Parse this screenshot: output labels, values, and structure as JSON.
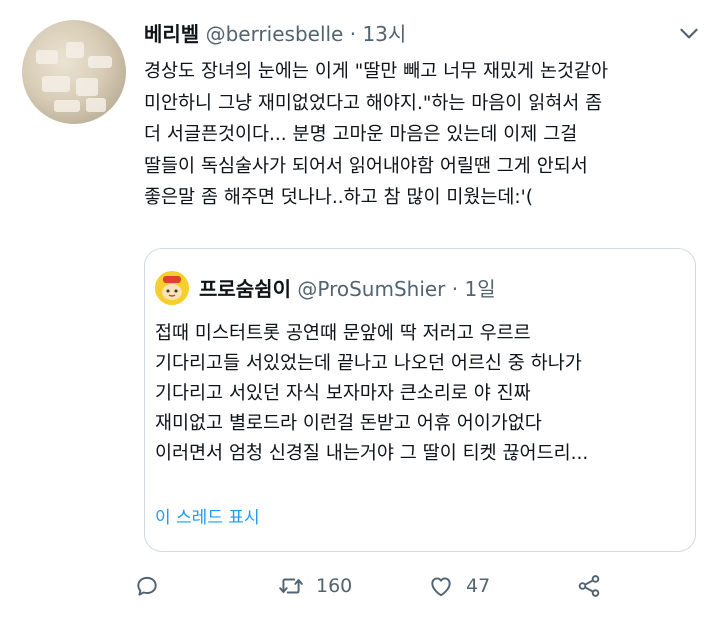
{
  "tweet": {
    "author_name": "베리벨",
    "author_handle": "@berriesbelle",
    "separator": "·",
    "time": "13시",
    "lines": [
      "경상도 장녀의 눈에는 이게 \"딸만 빼고 너무 재밌게 논것같아",
      "미안하니 그냥 재미없었다고 해야지.\"하는 마음이 읽혀서 좀",
      "더 서글픈것이다... 분명 고마운 마음은 있는데 이제 그걸",
      "딸들이 독심술사가 되어서 읽어내야함 어릴땐 그게 안되서",
      "좋은말 좀 해주면 덧나나..하고 참 많이 미웠는데:'("
    ]
  },
  "quote": {
    "author_name": "프로숨쉼이",
    "author_handle": "@ProSumShier",
    "separator": "·",
    "time": "1일",
    "lines": [
      "접때 미스터트롯 공연때 문앞에 딱 저러고 우르르",
      "기다리고들 서있었는데 끝나고 나오던 어르신 중 하나가",
      "기다리고 서있던 자식 보자마자 큰소리로 야 진짜",
      "재미없고 별로드라 이런걸 돈받고 어휴 어이가없다",
      "이러면서 엄청 신경질 내는거야 그 딸이 티켓 끊어드리..."
    ],
    "thread_link": "이 스레드 표시"
  },
  "actions": {
    "retweet_count": "160",
    "like_count": "47"
  },
  "colors": {
    "accent": "#1d9bf0",
    "secondary_text": "#536471",
    "border": "#cfd9de"
  }
}
